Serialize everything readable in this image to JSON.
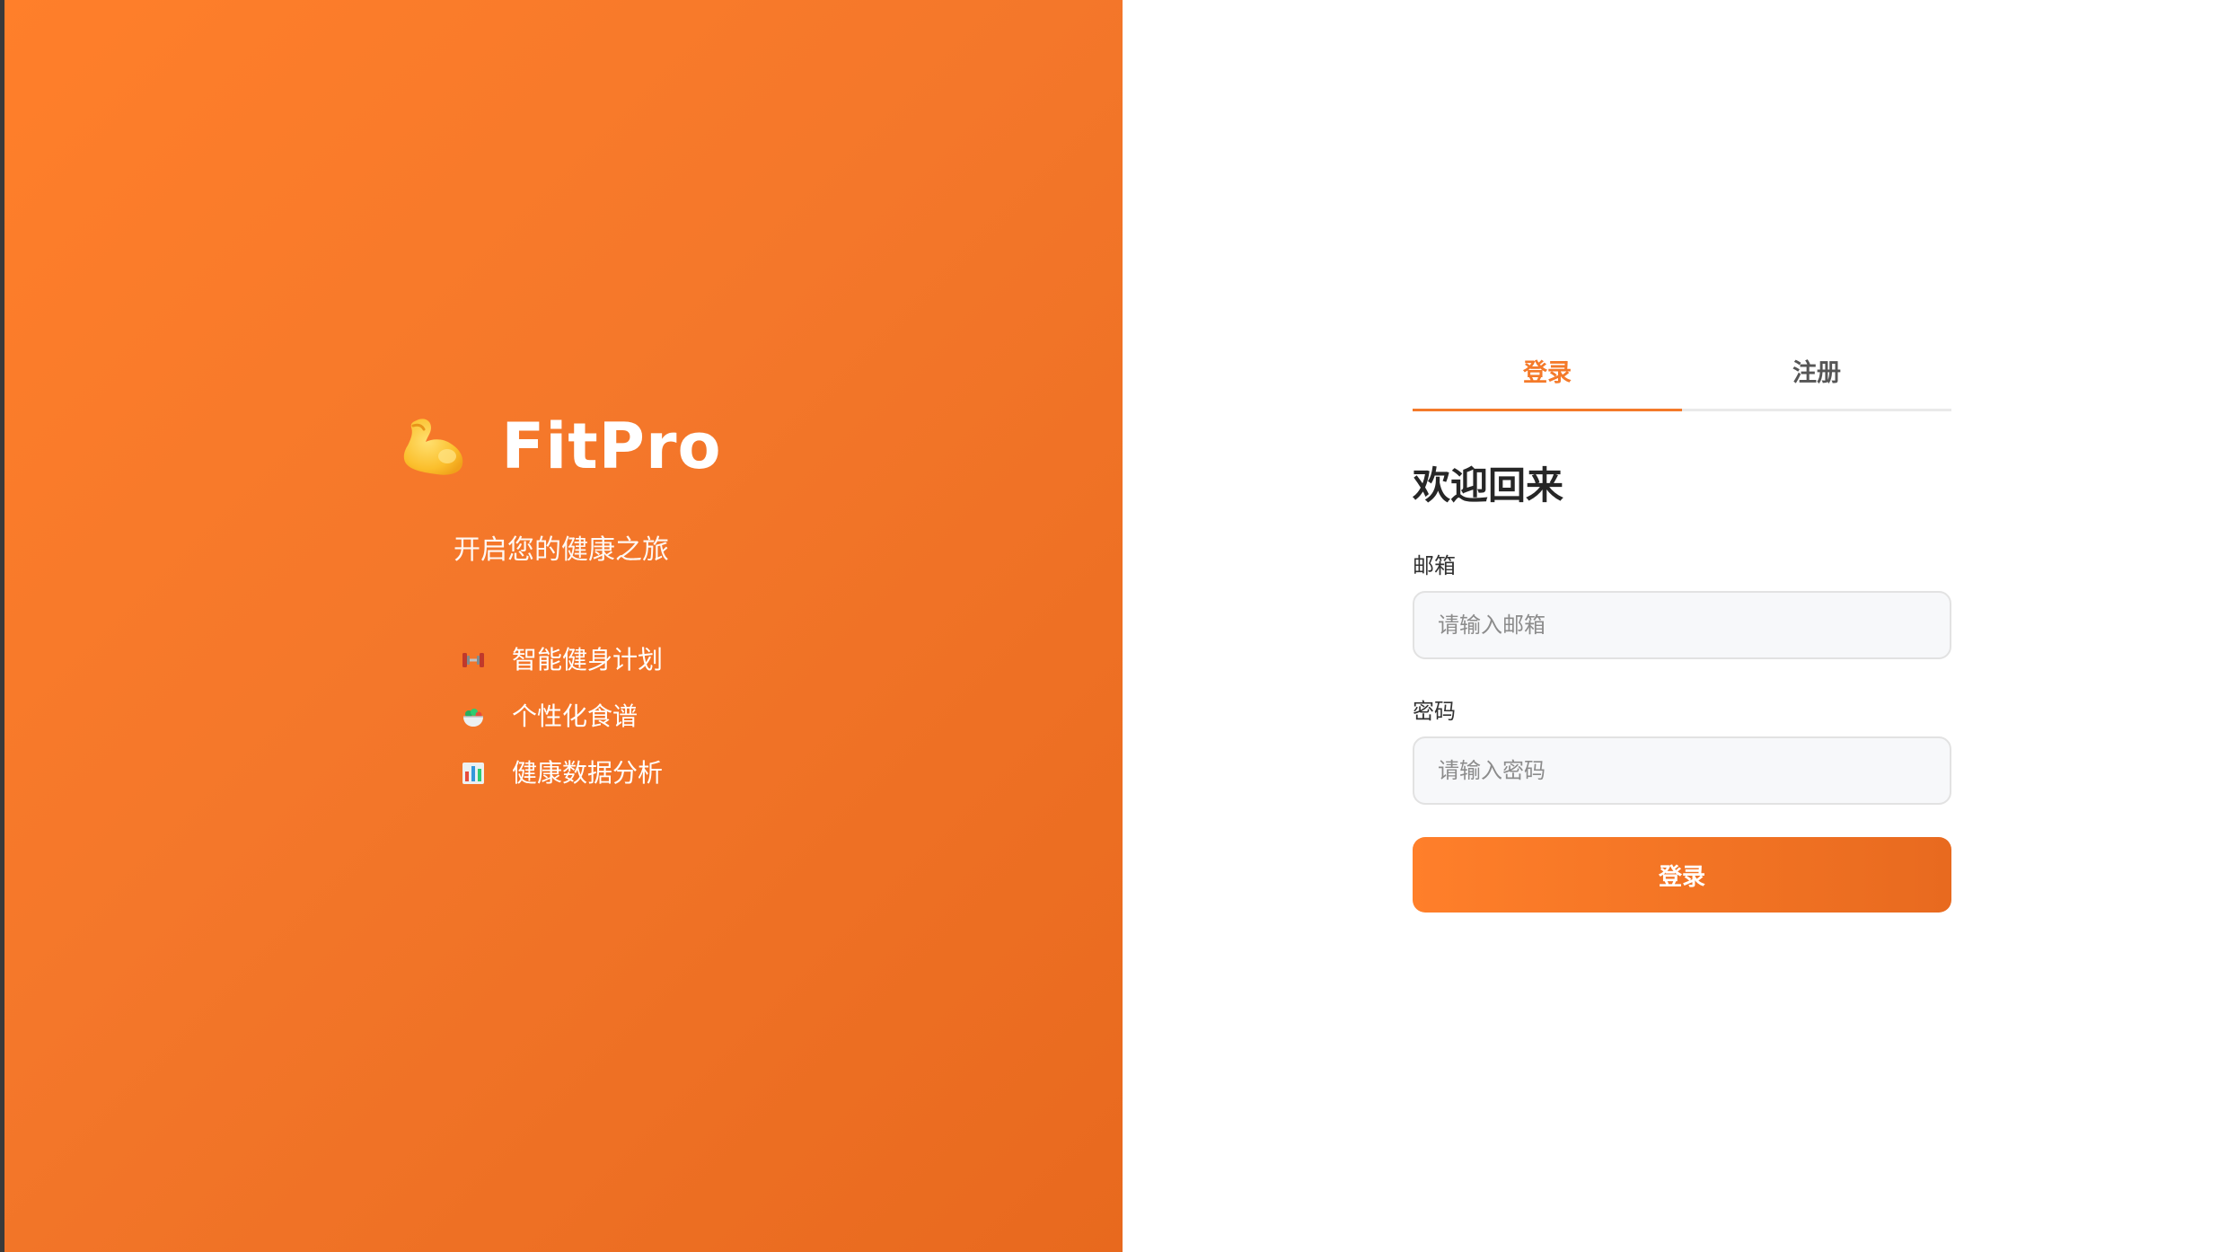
{
  "brand": {
    "logo_icon": "flexed-biceps-icon",
    "name": "FitPro",
    "tagline": "开启您的健康之旅",
    "features": [
      {
        "icon": "dumbbell-icon",
        "label": "智能健身计划"
      },
      {
        "icon": "salad-bowl-icon",
        "label": "个性化食谱"
      },
      {
        "icon": "bar-chart-icon",
        "label": "健康数据分析"
      }
    ]
  },
  "auth": {
    "tabs": [
      {
        "label": "登录",
        "active": true
      },
      {
        "label": "注册",
        "active": false
      }
    ],
    "title": "欢迎回来",
    "email": {
      "label": "邮箱",
      "placeholder": "请输入邮箱",
      "value": ""
    },
    "password": {
      "label": "密码",
      "placeholder": "请输入密码",
      "value": ""
    },
    "submit_label": "登录"
  },
  "colors": {
    "accent": "#f47a2a",
    "gradient_start": "#ff7f2a",
    "gradient_end": "#e8691e"
  }
}
